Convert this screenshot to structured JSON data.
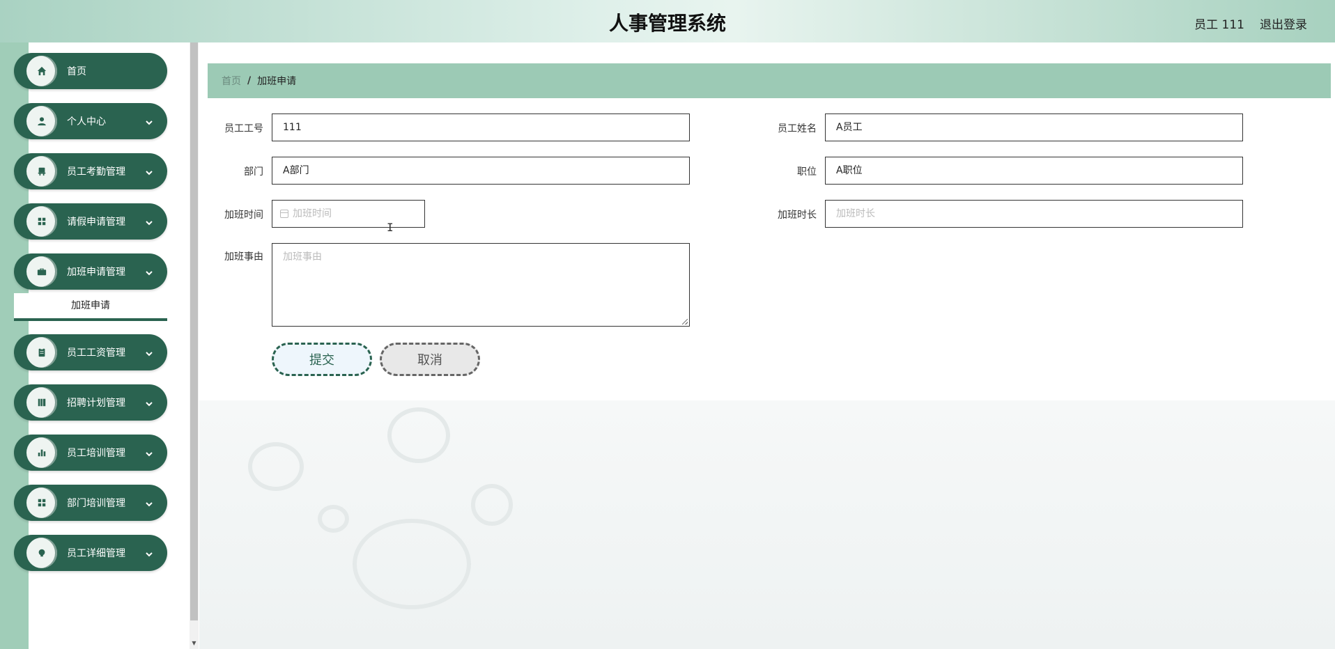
{
  "header": {
    "title": "人事管理系统",
    "user": "员工 111",
    "logout": "退出登录"
  },
  "sidebar": {
    "items": [
      {
        "label": "首页",
        "icon": "home-icon",
        "expandable": false
      },
      {
        "label": "个人中心",
        "icon": "person-icon",
        "expandable": true
      },
      {
        "label": "员工考勤管理",
        "icon": "chair-icon",
        "expandable": true
      },
      {
        "label": "请假申请管理",
        "icon": "grid-icon",
        "expandable": true
      },
      {
        "label": "加班申请管理",
        "icon": "briefcase-icon",
        "expandable": true
      },
      {
        "label": "员工工资管理",
        "icon": "clipboard-icon",
        "expandable": true
      },
      {
        "label": "招聘计划管理",
        "icon": "book-icon",
        "expandable": true
      },
      {
        "label": "员工培训管理",
        "icon": "bar-chart-icon",
        "expandable": true
      },
      {
        "label": "部门培训管理",
        "icon": "grid-icon",
        "expandable": true
      },
      {
        "label": "员工详细管理",
        "icon": "bulb-icon",
        "expandable": true
      }
    ],
    "submenu": {
      "label": "加班申请"
    }
  },
  "breadcrumb": {
    "home": "首页",
    "separator": "/",
    "current": "加班申请"
  },
  "form": {
    "employee_id": {
      "label": "员工工号",
      "value": "111"
    },
    "employee_name": {
      "label": "员工姓名",
      "value": "A员工"
    },
    "department": {
      "label": "部门",
      "value": "A部门"
    },
    "position": {
      "label": "职位",
      "value": "A职位"
    },
    "overtime_time": {
      "label": "加班时间",
      "placeholder": "加班时间"
    },
    "overtime_duration": {
      "label": "加班时长",
      "placeholder": "加班时长"
    },
    "overtime_reason": {
      "label": "加班事由",
      "placeholder": "加班事由"
    },
    "submit": "提交",
    "cancel": "取消"
  },
  "colors": {
    "accent": "#2a6350",
    "breadcrumb_bg": "#9ccab5",
    "sidebar_strip": "#a0cdb8"
  }
}
